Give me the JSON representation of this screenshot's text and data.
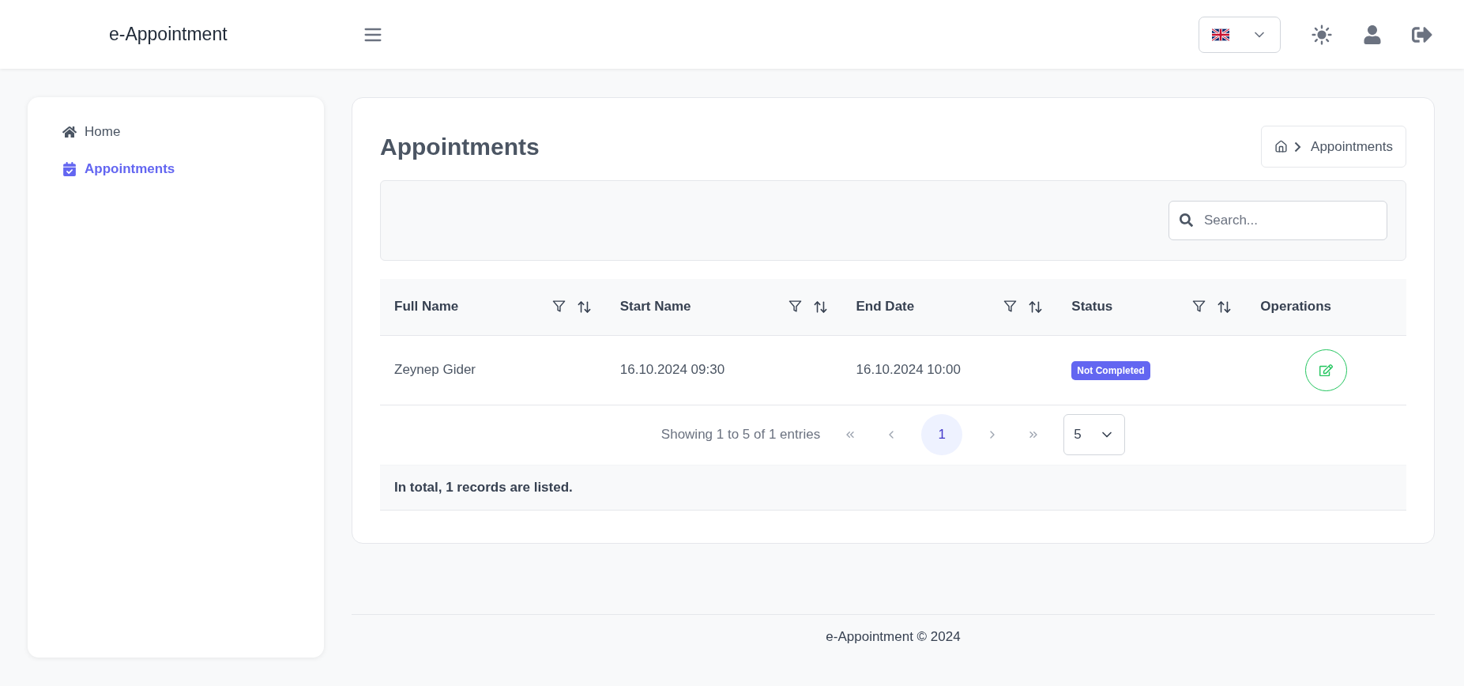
{
  "app_title": "e-Appointment",
  "sidebar": {
    "items": [
      {
        "label": "Home",
        "kind": "home",
        "selected": false
      },
      {
        "label": "Appointments",
        "kind": "calendar",
        "selected": true
      }
    ]
  },
  "page": {
    "title": "Appointments",
    "breadcrumb": [
      "Appointments"
    ]
  },
  "search": {
    "placeholder": "Search..."
  },
  "table": {
    "columns": [
      {
        "label": "Full Name",
        "filterable": true
      },
      {
        "label": "Start Name",
        "filterable": true
      },
      {
        "label": "End Date",
        "filterable": true
      },
      {
        "label": "Status",
        "filterable": true
      },
      {
        "label": "Operations",
        "filterable": false
      }
    ],
    "rows": [
      {
        "full_name": "Zeynep Gider",
        "start": "16.10.2024 09:30",
        "end": "16.10.2024 10:00",
        "status": "Not Completed"
      }
    ]
  },
  "pagination": {
    "summary": "Showing 1 to 5 of 1 entries",
    "pages": [
      {
        "label": "1",
        "selected": true
      }
    ],
    "page_size": "5"
  },
  "total": "In total, 1 records are listed.",
  "footer": "e-Appointment © 2024"
}
